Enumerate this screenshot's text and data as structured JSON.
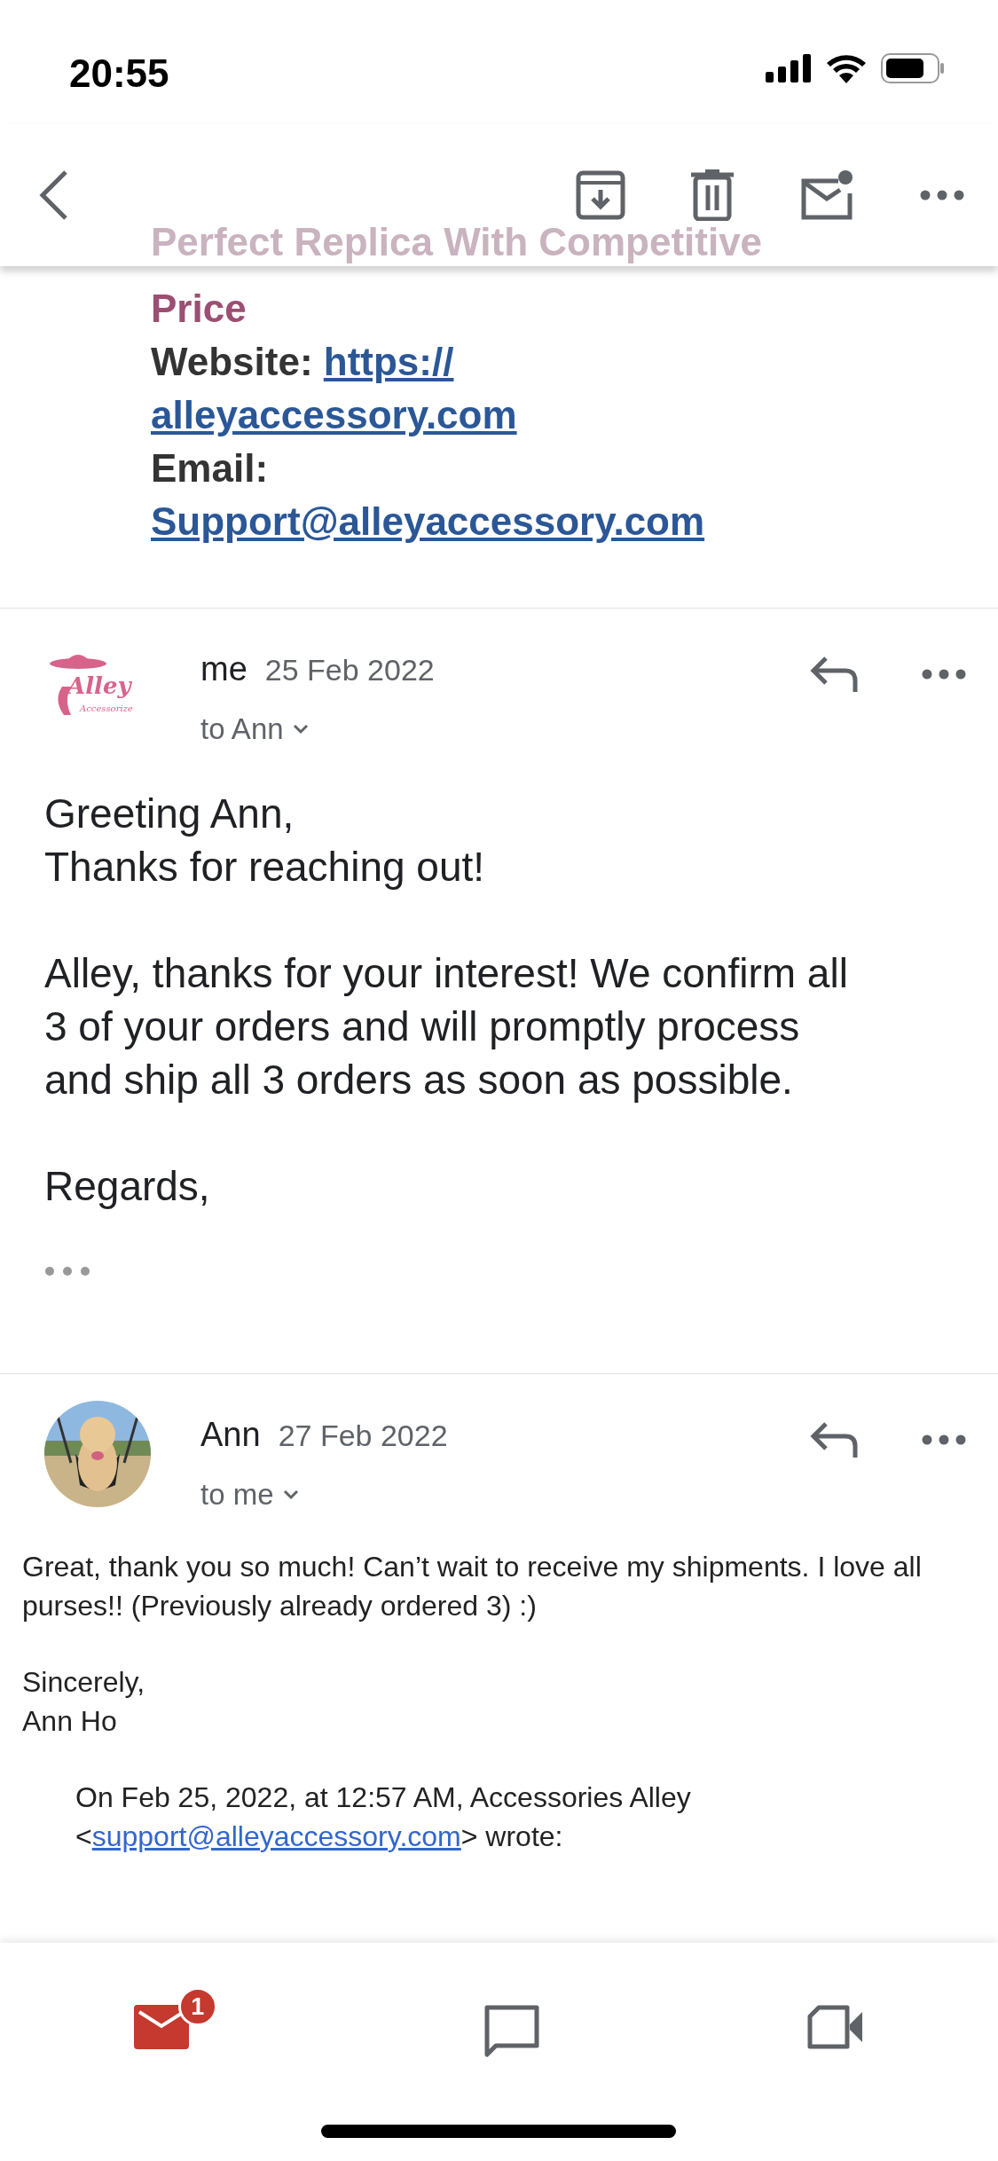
{
  "status_bar": {
    "time": "20:55"
  },
  "toolbar": {
    "faded_text": "Perfect Replica With Competitive"
  },
  "signature": {
    "tagline": "Price",
    "website_label": "Website:",
    "website_lines": [
      "https://",
      "alleyaccessory.com"
    ],
    "email_label": "Email:",
    "email": "Support@alleyaccessory.com"
  },
  "messages": [
    {
      "kind": "formatted",
      "sender": "me",
      "date": "25 Feb 2022",
      "recipients": "to Ann",
      "avatar": {
        "kind": "logo",
        "title": "Alley",
        "subtitle": "Accessorize"
      },
      "paragraphs": [
        [
          "Greeting Ann,",
          "Thanks for reaching out!"
        ],
        [
          "Alley, thanks for your interest! We confirm all 3 of your orders and will promptly process and ship all 3 orders as soon as possible."
        ],
        [
          "Regards,"
        ]
      ],
      "trimmed_content": true
    },
    {
      "kind": "plain",
      "sender": "Ann",
      "date": "27 Feb 2022",
      "recipients": "to me",
      "avatar": {
        "kind": "picture"
      },
      "paragraphs": [
        [
          "Great, thank you so much! Can’t wait to receive my shipments. I love all",
          "purses!! (Previously already ordered 3) :)"
        ],
        [
          "Sincerely,",
          "Ann Ho"
        ]
      ],
      "quote": {
        "intro": "On Feb 25, 2022, at 12:57 AM, Accessories Alley",
        "open": "<",
        "link": "support@alleyaccessory.com",
        "close": "> wrote:"
      }
    }
  ],
  "bottom_nav": [
    {
      "kind": "mail",
      "selected": true,
      "badge": "1"
    },
    {
      "kind": "chat",
      "selected": false
    },
    {
      "kind": "video",
      "selected": false
    }
  ]
}
